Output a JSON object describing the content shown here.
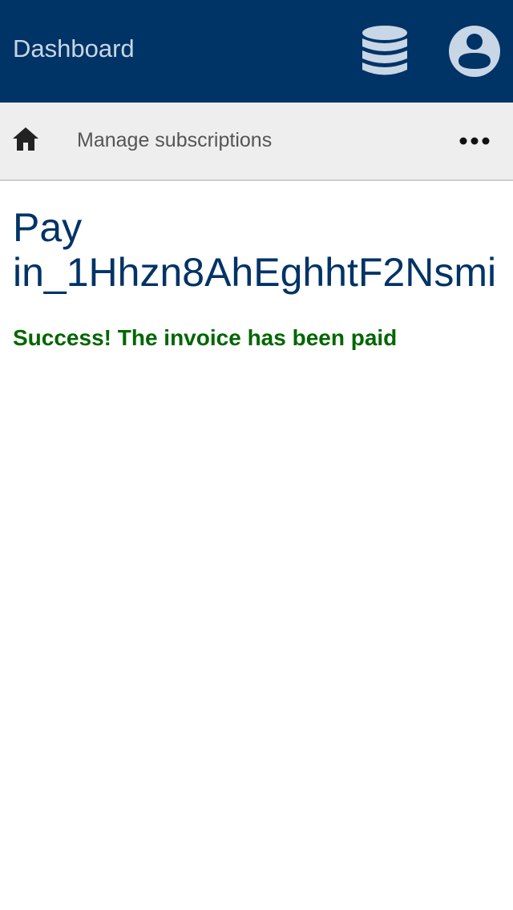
{
  "header": {
    "title": "Dashboard",
    "database_icon": "database-icon",
    "account_icon": "account-circle-icon",
    "background_color": "#003366"
  },
  "subnav": {
    "home_icon": "home-icon",
    "link_label": "Manage subscriptions",
    "more_icon": "more-horizontal-icon"
  },
  "main": {
    "title_line1": "Pay",
    "title_line2": "in_1Hhzn8AhEghhtF2Nsmi",
    "status_message": "Success! The invoice has been paid",
    "status_color": "#006600"
  }
}
